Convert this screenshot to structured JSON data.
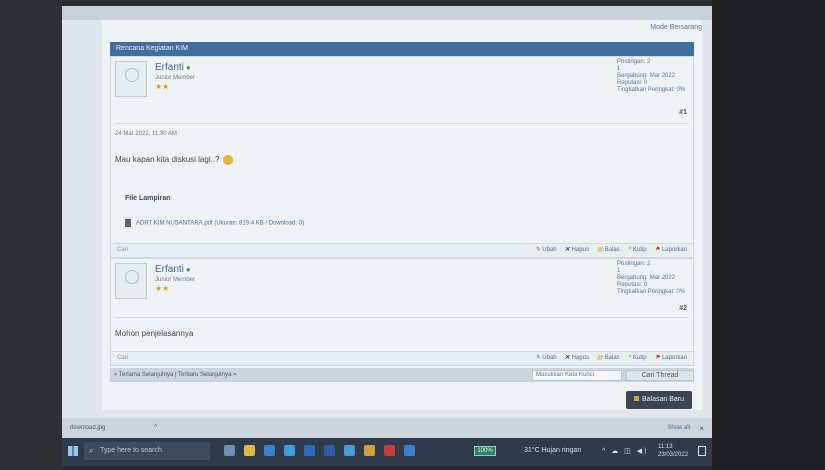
{
  "page": {
    "top_link": "Mode Bersarang",
    "thread_title": "Rencana Kegiatan KIM"
  },
  "posts": [
    {
      "username": "Erfanti",
      "online": "●",
      "rank": "Junior Member",
      "stars": "★★",
      "stats": [
        "Postingan: 2",
        "1",
        "Bergabung: Mar 2022",
        "Reputasi: 0",
        "Tingkatkan Peringkat: 0%"
      ],
      "post_number": "#1",
      "date": "24 Mar 2022, 11:30 AM",
      "body": "Mau kapan kita diskusi lagi..?",
      "attachment_title": "File Lampiran",
      "attachment_file": "ADRT KIM NUSANTARA.pdf (Ukuran: 819.4 KB / Download: 0)"
    },
    {
      "username": "Erfanti",
      "online": "●",
      "rank": "Junior Member",
      "stars": "★★",
      "stats": [
        "Postingan: 2",
        "1",
        "Bergabung: Mar 2022",
        "Reputasi: 0",
        "Tingkatkan Peringkat: 0%"
      ],
      "post_number": "#2",
      "body": "Mohon penjelasannya"
    }
  ],
  "actions": {
    "cite": "Cari",
    "edit": "Ubah",
    "delete": "Hapus",
    "reply": "Balas",
    "quote": "Kutip",
    "report": "Laporkan"
  },
  "nav": {
    "prev_next": "« Terlama Selanjutnya | Terbaru Selanjutnya »",
    "search_placeholder": "Masukkan Kata Kunci",
    "search_button": "Cari Thread",
    "new_reply": "Balasan Baru"
  },
  "download_bar": {
    "file": "download.jpg",
    "show_all": "Show all",
    "close": "×"
  },
  "taskbar": {
    "search_placeholder": "Type here to search",
    "zoom": "100%",
    "weather": "31°C Hujan ringan",
    "time": "11:13",
    "date": "23/03/2022"
  },
  "colors": {
    "header": "#3f6e9e",
    "taskbar": "#2f3a4a",
    "button": "#3b4553"
  }
}
